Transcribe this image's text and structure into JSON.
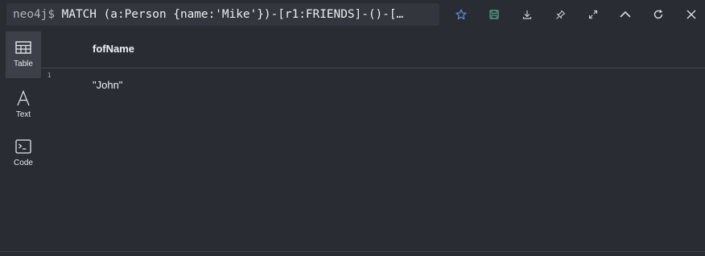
{
  "command": {
    "prompt": "neo4j$",
    "query": "MATCH (a:Person {name:'Mike'})-[r1:FRIENDS]-()-[…"
  },
  "toolbar": {
    "icons": [
      "star-icon",
      "save-icon",
      "download-icon",
      "pin-icon",
      "expand-icon",
      "collapse-icon",
      "rerun-icon",
      "close-icon"
    ]
  },
  "sidebar": {
    "items": [
      {
        "label": "Table",
        "icon": "table-icon",
        "active": true
      },
      {
        "label": "Text",
        "icon": "text-icon",
        "active": false
      },
      {
        "label": "Code",
        "icon": "code-icon",
        "active": false
      }
    ]
  },
  "table": {
    "columns": [
      "fofName"
    ],
    "rows": [
      {
        "num": "1",
        "cells": [
          "\"John\""
        ]
      }
    ]
  },
  "colors": {
    "background": "#2a2c33",
    "command_bg": "#33363e",
    "active_tab": "#3d4049",
    "star": "#5b8fd6",
    "save": "#4fae8f"
  }
}
